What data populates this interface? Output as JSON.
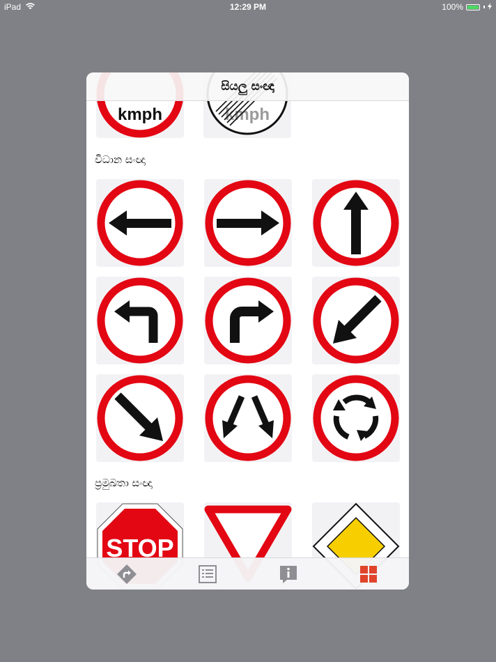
{
  "status_bar": {
    "device": "iPad",
    "time": "12:29 PM",
    "battery": "100%"
  },
  "header": {
    "title": "සියලු සංඥා"
  },
  "sections": [
    {
      "id": "mandatory",
      "title": "විධාන සංඥා"
    },
    {
      "id": "priority",
      "title": "ප්‍රමුඛතා සංඥා"
    }
  ],
  "signs": {
    "top_partial": [
      "kmph",
      "kmph"
    ],
    "stop_text": "STOP"
  },
  "tabs": [
    {
      "icon": "route-sign-icon"
    },
    {
      "icon": "list-icon"
    },
    {
      "icon": "info-icon"
    },
    {
      "icon": "grid-icon",
      "selected": true
    }
  ],
  "colors": {
    "sign_red": "#e30613",
    "tab_selected": "#e0452b",
    "tab_normal": "#8e8e93",
    "priority_yellow": "#f7cf00"
  }
}
